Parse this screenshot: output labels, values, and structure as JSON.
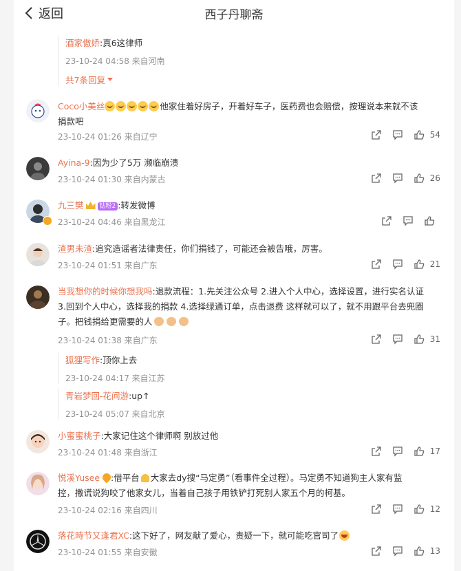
{
  "header": {
    "back_label": "返回",
    "title": "西子丹聊斋"
  },
  "top_reply": {
    "user": "酒家傲娇",
    "text": ":真6这律师",
    "meta": "23-10-24 04:58 来自河南",
    "more_label": "共7条回复"
  },
  "comments": [
    {
      "user": "Coco小美丝",
      "text_line1": "他家住着好房子，开着好车子，医药费也会赔偿，按理说本来就不该",
      "text_line2": "捐款吧",
      "meta": "23-10-24 01:26 来自辽宁",
      "likes": "54"
    },
    {
      "user": "Ayina-9",
      "text": ":因为少了5万 濒临崩溃",
      "meta": "23-10-24 01:30 来自内蒙古",
      "likes": "26"
    },
    {
      "user": "九三樊",
      "badge": "钻粉2",
      "text": ":转发微博",
      "meta": "23-10-24 04:46 来自黑龙江",
      "likes": ""
    },
    {
      "user": "渣男未渣",
      "text": ":追究造谣者法律责任，你们捐钱了，可能还会被告哦，厉害。",
      "meta": "23-10-24 01:51 来自广东",
      "likes": "21"
    },
    {
      "user": "当我想你的时候你想我吗",
      "text_line1": ":退款流程：1.先关注公众号 2.进入个人中心，选择设置，进行实名认证",
      "text_line2": "3.回到个人中心，选择我的捐款 4.选择绿通订单，点击退费 这样就可以了，就不用跟平台去兜圈",
      "text_line3": "子。把钱捐给更需要的人",
      "meta": "23-10-24 01:38 来自广东",
      "likes": "31",
      "replies": [
        {
          "user": "狐狸写作",
          "text": ":顶你上去",
          "meta": "23-10-24 04:17 来自江苏"
        },
        {
          "user": "青岩梦回-花间游",
          "text": ":up↑",
          "meta": "23-10-24 05:07 来自北京"
        }
      ]
    },
    {
      "user": "小蜜蜜桃子",
      "text": ":大家记住这个律师啊 别放过他",
      "meta": "23-10-24 01:48 来自浙江",
      "likes": "17"
    },
    {
      "user": "悦溪Yusee",
      "text_line1a": ":借平台",
      "text_line1b": "大家去dy搜“马定勇”（看事件全过程）。马定勇不知道狗主人家有监",
      "text_line2": "控，撒谎说狗咬了他家女儿，当着自己孩子用铁铲打死别人家五个月的柯基。",
      "meta": "23-10-24 02:16 来自四川",
      "likes": "12"
    },
    {
      "user": "落花時节又逢君XC",
      "text": ":这下好了，网友献了爱心，责疑一下，就可能吃官司了",
      "meta": "23-10-24 01:55 来自安徽",
      "likes": "13"
    }
  ],
  "icons": {
    "share": "share-icon",
    "comment": "comment-icon",
    "like": "thumbs-up-icon",
    "back": "chevron-left-icon"
  },
  "colors": {
    "username": "#eb7350",
    "meta": "#939393",
    "text": "#333333",
    "background": "#f5f5f5"
  }
}
